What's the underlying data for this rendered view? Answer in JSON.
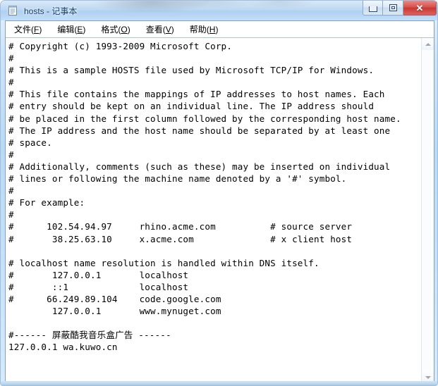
{
  "window": {
    "title": "hosts - 记事本",
    "app_icon": "notepad-icon",
    "controls": {
      "minimize_label": "─",
      "maximize_label": "❐",
      "close_label": "✕"
    },
    "accent_close_color": "#c63a36",
    "titlebar_color": "#b9d7f2",
    "client_background": "#ffffff"
  },
  "menubar": {
    "items": [
      {
        "text": "文件",
        "accel": "F"
      },
      {
        "text": "编辑",
        "accel": "E"
      },
      {
        "text": "格式",
        "accel": "O"
      },
      {
        "text": "查看",
        "accel": "V"
      },
      {
        "text": "帮助",
        "accel": "H"
      }
    ]
  },
  "editor": {
    "filename": "hosts",
    "content": "# Copyright (c) 1993-2009 Microsoft Corp.\n#\n# This is a sample HOSTS file used by Microsoft TCP/IP for Windows.\n#\n# This file contains the mappings of IP addresses to host names. Each\n# entry should be kept on an individual line. The IP address should\n# be placed in the first column followed by the corresponding host name.\n# The IP address and the host name should be separated by at least one\n# space.\n#\n# Additionally, comments (such as these) may be inserted on individual\n# lines or following the machine name denoted by a '#' symbol.\n#\n# For example:\n#\n#      102.54.94.97     rhino.acme.com          # source server\n#       38.25.63.10     x.acme.com              # x client host\n\n# localhost name resolution is handled within DNS itself.\n#       127.0.0.1       localhost\n#       ::1             localhost\n#      66.249.89.104    code.google.com\n        127.0.0.1       www.mynuget.com\n\n#------ 屏蔽酷我音乐盒广告 ------\n127.0.0.1 wa.kuwo.cn",
    "lines": [
      "# Copyright (c) 1993-2009 Microsoft Corp.",
      "#",
      "# This is a sample HOSTS file used by Microsoft TCP/IP for Windows.",
      "#",
      "# This file contains the mappings of IP addresses to host names. Each",
      "# entry should be kept on an individual line. The IP address should",
      "# be placed in the first column followed by the corresponding host name.",
      "# The IP address and the host name should be separated by at least one",
      "# space.",
      "#",
      "# Additionally, comments (such as these) may be inserted on individual",
      "# lines or following the machine name denoted by a '#' symbol.",
      "#",
      "# For example:",
      "#",
      "#      102.54.94.97     rhino.acme.com          # source server",
      "#       38.25.63.10     x.acme.com              # x client host",
      "",
      "# localhost name resolution is handled within DNS itself.",
      "#       127.0.0.1       localhost",
      "#       ::1             localhost",
      "#      66.249.89.104    code.google.com",
      "        127.0.0.1       www.mynuget.com",
      "",
      "#------ 屏蔽酷我音乐盒广告 ------",
      "127.0.0.1 wa.kuwo.cn"
    ]
  },
  "scrollbar": {
    "up_arrow": "scroll-up-arrow",
    "down_arrow": "scroll-down-arrow",
    "orientation": "vertical"
  }
}
